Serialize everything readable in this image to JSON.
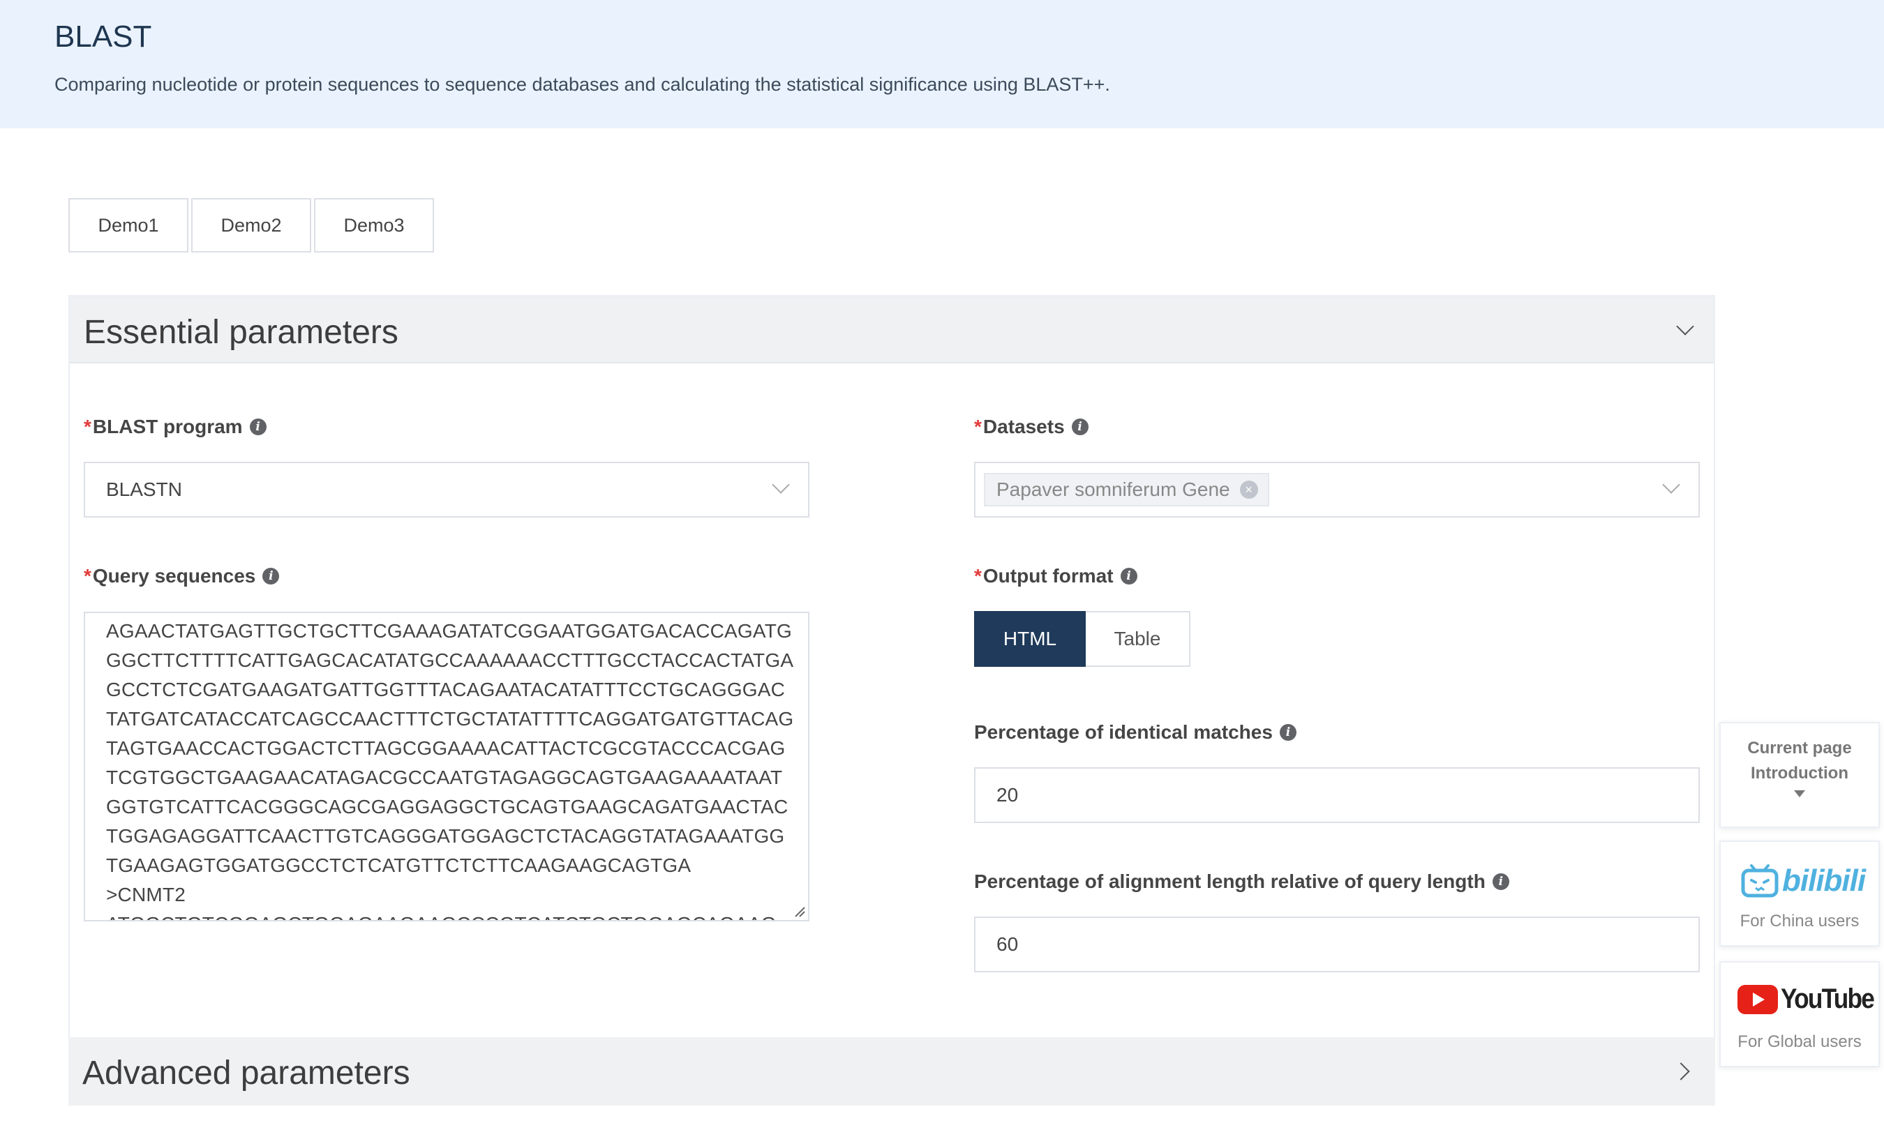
{
  "header": {
    "title": "BLAST",
    "subtitle": "Comparing nucleotide or protein sequences to sequence databases and calculating the statistical significance using BLAST++."
  },
  "demos": [
    "Demo1",
    "Demo2",
    "Demo3"
  ],
  "essential": {
    "title": "Essential parameters",
    "program": {
      "label": "BLAST program",
      "required_mark": "*",
      "value": "BLASTN"
    },
    "datasets": {
      "label": "Datasets",
      "required_mark": "*",
      "tag": "Papaver somniferum Gene"
    },
    "query": {
      "label": "Query sequences",
      "required_mark": "*",
      "lines": [
        "AGAACTATGAGTTGCTGCTTCGAAAGATATCGGAATGGATGACACCAGATG",
        "GGCTTCTTTTCATTGAGCACATATGCCAAAAAACCTTTGCCTACCACTATGA",
        "GCCTCTCGATGAAGATGATTGGTTTACAGAATACATATTTCCTGCAGGGAC",
        "TATGATCATACCATCAGCCAACTTTCTGCTATATTTTCAGGATGATGTTACAG",
        "TAGTGAACCACTGGACTCTTAGCGGAAAACATTACTCGCGTACCCACGAG",
        "TCGTGGCTGAAGAACATAGACGCCAATGTAGAGGCAGTGAAGAAAATAAT",
        "GGTGTCATTCACGGGCAGCGAGGAGGCTGCAGTGAAGCAGATGAACTAC",
        "TGGAGAGGATTCAACTTGTCAGGGATGGAGCTCTACAGGTATAGAAATGG",
        "TGAAGAGTGGATGGCCTCTCATGTTCTCTTCAAGAAGCAGTGA",
        ">CNMT2",
        "ATGGCTGTCGGAGCTGGAGAAGAAGCCCGTCATCTGCTGGAGCAGAAG"
      ]
    },
    "output_format": {
      "label": "Output format",
      "required_mark": "*",
      "options": [
        "HTML",
        "Table"
      ],
      "selected": "HTML"
    },
    "identity": {
      "label": "Percentage of identical matches",
      "value": "20"
    },
    "coverage": {
      "label": "Percentage of alignment length relative of query length",
      "value": "60"
    }
  },
  "advanced": {
    "title": "Advanced parameters"
  },
  "side": {
    "intro_line1": "Current page",
    "intro_line2": "Introduction",
    "bilibili_logo": "bilibili",
    "bilibili_caption": "For China users",
    "youtube_logo": "YouTube",
    "youtube_caption": "For Global users"
  },
  "colors": {
    "header_bg": "#eaf3fd",
    "active_button": "#1f3a5a",
    "required": "#e23b3b",
    "bilibili": "#4fb1df",
    "youtube": "#e62117"
  }
}
